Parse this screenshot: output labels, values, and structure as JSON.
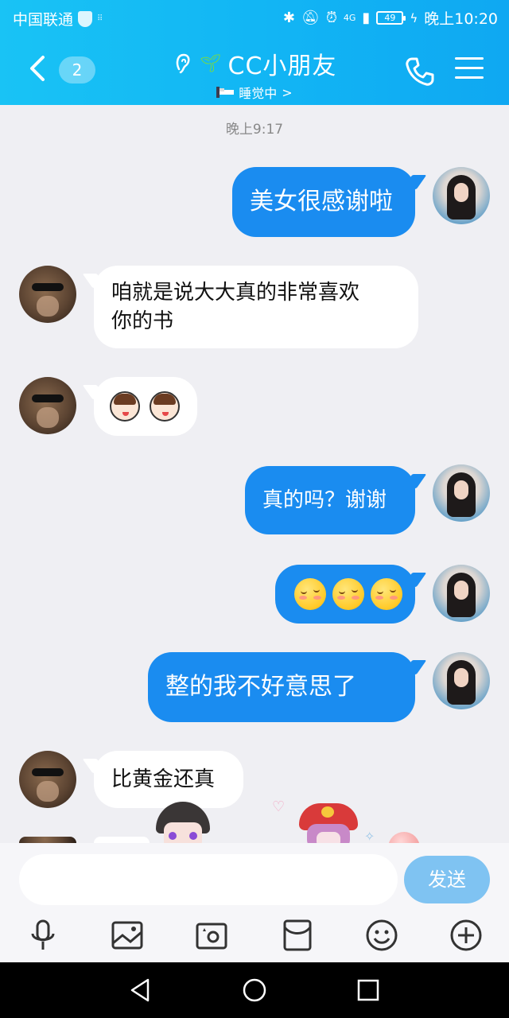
{
  "status_bar": {
    "carrier": "中国联通",
    "network": "4G",
    "battery": "49",
    "time": "晚上10:20"
  },
  "header": {
    "unread_count": "2",
    "chat_title": "CC小朋友",
    "status_text": "睡觉中",
    "status_chevron": ">"
  },
  "messages": {
    "timestamp": "晚上9:17",
    "m1": {
      "side": "out",
      "text": "美女很感谢啦"
    },
    "m2": {
      "side": "in",
      "text": "咱就是说大大真的非常喜欢\n你的书"
    },
    "m3": {
      "side": "in",
      "emoji": "boy-face-emoji",
      "count": 2
    },
    "m4": {
      "side": "out",
      "text": "真的吗？谢谢"
    },
    "m5": {
      "side": "out",
      "emoji": "blushing-face-emoji",
      "count": 3
    },
    "m6": {
      "side": "out",
      "text": "整的我不好意思了"
    },
    "m7": {
      "side": "in",
      "text": "比黄金还真"
    }
  },
  "input": {
    "placeholder": "",
    "send_label": "发送"
  },
  "toolbar": [
    "microphone-icon",
    "image-icon",
    "camera-icon",
    "red-packet-icon",
    "emoji-icon",
    "plus-icon"
  ],
  "colors": {
    "header": "#12b6f4",
    "bubble_out": "#1a8cf0",
    "bubble_in": "#ffffff",
    "send_button": "#7fc3f2",
    "background": "#efeff3"
  }
}
